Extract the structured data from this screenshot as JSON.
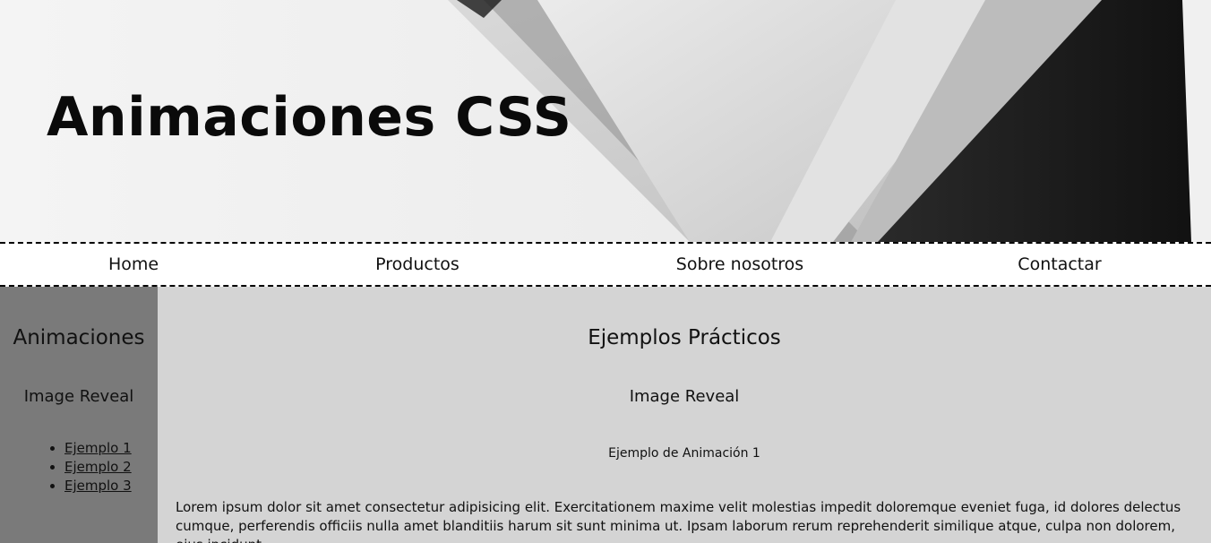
{
  "header": {
    "title": "Animaciones CSS"
  },
  "nav": {
    "items": [
      {
        "label": "Home"
      },
      {
        "label": "Productos"
      },
      {
        "label": "Sobre nosotros"
      },
      {
        "label": "Contactar"
      }
    ]
  },
  "sidebar": {
    "title": "Animaciones",
    "subtitle": "Image Reveal",
    "links": [
      {
        "label": "Ejemplo 1"
      },
      {
        "label": "Ejemplo 2"
      },
      {
        "label": "Ejemplo 3"
      }
    ]
  },
  "main": {
    "title": "Ejemplos Prácticos",
    "subtitle": "Image Reveal",
    "example_title": "Ejemplo de Animación 1",
    "paragraph": "Lorem ipsum dolor sit amet consectetur adipisicing elit. Exercitationem maxime velit molestias impedit doloremque eveniet fuga, id dolores delectus cumque, perferendis officiis nulla amet blanditiis harum sit sunt minima ut. Ipsam laborum rerum reprehenderit similique atque, culpa non dolorem, eius incidunt"
  },
  "colors": {
    "sidebar_bg": "#7a7a7a",
    "main_bg": "#d4d4d4",
    "nav_bg": "#ffffff"
  }
}
